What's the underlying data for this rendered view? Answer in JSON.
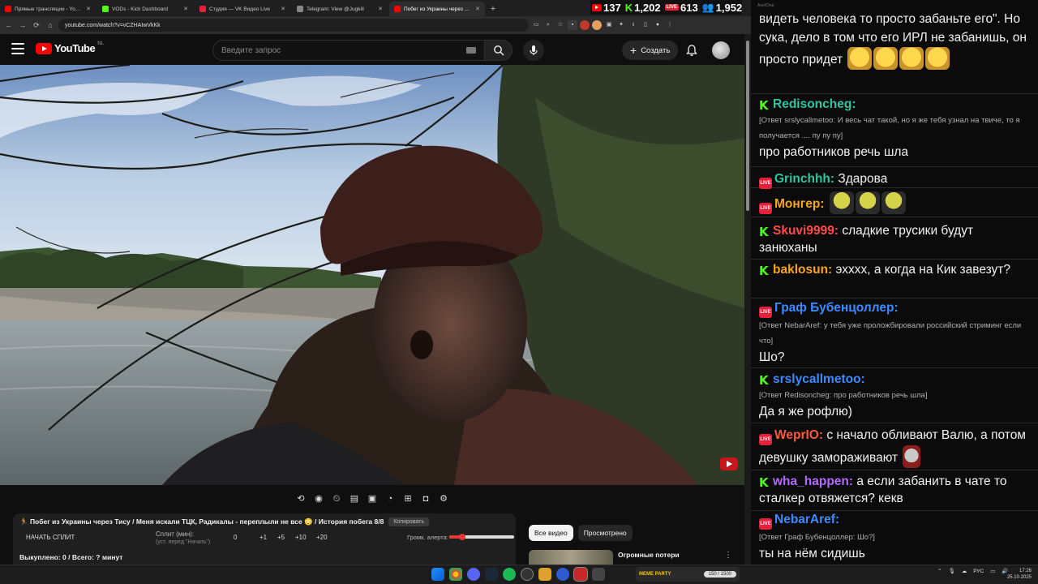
{
  "browser": {
    "tabs": [
      {
        "label": "Прямые трансляции - YouTube",
        "color": "#ff0000",
        "active": false
      },
      {
        "label": "VODs - Kick Dashboard",
        "color": "#53fc18",
        "active": false
      },
      {
        "label": "Студия — VK Видео Live",
        "color": "#e5213a",
        "active": false
      },
      {
        "label": "Telegram: View @Jugkill",
        "color": "#888888",
        "active": false
      },
      {
        "label": "Побег из Украины через Ти...",
        "color": "#ff0000",
        "active": true
      }
    ],
    "url": "youtube.com/watch?v=vCZHAIwVkKk"
  },
  "youtube": {
    "logo_text": "YouTube",
    "region": "NL",
    "search_placeholder": "Введите запрос",
    "create_label": "Создать"
  },
  "stats": {
    "youtube": "137",
    "kick": "1,202",
    "vk_live": "613",
    "vk_live_badge": "LIVE",
    "total": "1,952"
  },
  "info_panel": {
    "title": "🏃 Побег из Украины через Тису / Меня искали ТЦК, Радикалы - переплыли не все 😳 / История побега 8/8",
    "copy_label": "Копировать",
    "split_start": "НАЧАТЬ СПЛИТ",
    "split_label": "Сплит (мин):",
    "split_hint": "(уст. перед \"Начать\")",
    "split_values": [
      "0",
      "+1",
      "+5",
      "+10",
      "+20"
    ],
    "alert_label": "Громк. алерта:",
    "alert_level": 0.2,
    "bought": "Выкуплено: 0 / Всего: ? минут"
  },
  "recommendations": {
    "chips": [
      {
        "label": "Все видео",
        "active": true
      },
      {
        "label": "Просмотрено",
        "active": false
      }
    ],
    "first_title": "Огромные потери"
  },
  "chat": {
    "window_title": "AxelChat",
    "messages": [
      {
        "platform": "none",
        "user": "",
        "color": "#ffffff",
        "text": "видеть человека то просто забаньте его\". Но сука, дело в том что его ИРЛ не забанишь, он просто придет",
        "reply": ""
      },
      {
        "platform": "kick",
        "user": "Redisoncheg:",
        "color": "#2fc6a0",
        "text": "про работников речь шла",
        "reply": "[Ответ srslycallmetoo: И весь чат такой, но я же тебя узнал на твиче, то я получается .... пу пу пу]"
      },
      {
        "platform": "vk",
        "user": "Grinchhh:",
        "color": "#2fc6a0",
        "text": "Здарова",
        "reply": ""
      },
      {
        "platform": "vk",
        "user": "Монгер:",
        "color": "#f5a623",
        "text": "",
        "reply": ""
      },
      {
        "platform": "kick",
        "user": "Skuvi9999:",
        "color": "#ff4b4b",
        "text": "сладкие трусики будут занюханы",
        "reply": ""
      },
      {
        "platform": "kick",
        "user": "baklosun:",
        "color": "#f5a623",
        "text": "эхххх, а когда на Кик завезут?",
        "reply": ""
      },
      {
        "platform": "vk",
        "user": "Граф Бубенцоллер:",
        "color": "#3d8bff",
        "text": "Шо?",
        "reply": "[Ответ NebarAref: у тебя уже проложбировали российский стриминг если что]"
      },
      {
        "platform": "kick",
        "user": "srslycallmetoo:",
        "color": "#3d8bff",
        "text": "Да я же рофлю)",
        "reply": "[Ответ Redisoncheg: про работников речь шла]"
      },
      {
        "platform": "vk",
        "user": "WeprIO:",
        "color": "#ff5a3c",
        "text": "с начало обливают Валю, а потом девушку замораживают",
        "reply": ""
      },
      {
        "platform": "kick",
        "user": "wha_happen:",
        "color": "#b36bff",
        "text": "а если забанить в чате то сталкер отвяжется? кекв",
        "reply": ""
      },
      {
        "platform": "vk",
        "user": "NebarAref:",
        "color": "#3d8bff",
        "text": "ты на нём сидишь",
        "reply": "[Ответ Граф Бубенцоллер: Шо?]"
      }
    ]
  },
  "taskbar": {
    "meme_label": "MEME PARTY",
    "meme_value": "150 / 1500",
    "lang": "РУС",
    "time": "17:26",
    "date": "25.10.2025"
  }
}
